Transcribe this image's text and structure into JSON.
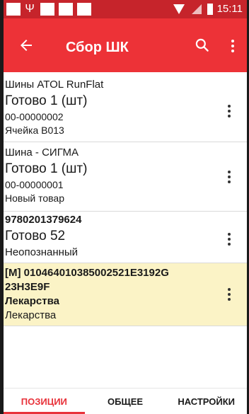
{
  "status_bar": {
    "time": "15:11"
  },
  "toolbar": {
    "title": "Сбор ШК"
  },
  "items": [
    {
      "name": "Шины ATOL RunFlat",
      "status": "Готово 1 (шт)",
      "code": "00-00000002",
      "note": "Ячейка B013"
    },
    {
      "name": "Шина - СИГМА",
      "status": "Готово 1 (шт)",
      "code": "00-00000001",
      "note": "Новый товар"
    },
    {
      "name": "9780201379624",
      "status": "Готово 52",
      "note": "Неопознанный"
    },
    {
      "name_line1": "[M] 010464010385002521E3192G",
      "name_line2": "23H3E9F",
      "bold_note": "Лекарства",
      "note": "Лекарства"
    }
  ],
  "tabs": [
    "ПОЗИЦИИ",
    "ОБЩЕЕ",
    "НАСТРОЙКИ"
  ],
  "colors": {
    "toolbar": "#ed3237",
    "status_bar": "#c6242b",
    "selected_row": "#fbf3c6",
    "active_tab": "#e8323a"
  },
  "icons": [
    "back-arrow-icon",
    "search-icon",
    "more-vert-icon"
  ]
}
